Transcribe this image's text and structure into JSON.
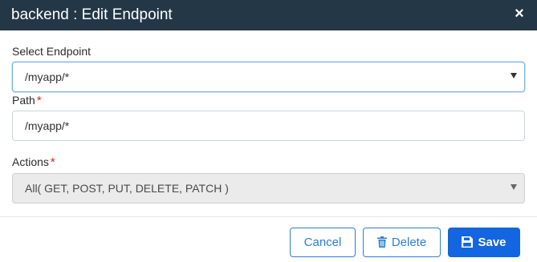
{
  "dialog": {
    "title": "backend : Edit Endpoint",
    "close_glyph": "×"
  },
  "form": {
    "select_endpoint": {
      "label": "Select Endpoint",
      "value": "/myapp/*"
    },
    "path": {
      "label": "Path",
      "required_mark": "*",
      "value": "/myapp/*"
    },
    "actions": {
      "label": "Actions",
      "required_mark": "*",
      "value": "All( GET, POST, PUT, DELETE, PATCH )"
    }
  },
  "footer": {
    "cancel_label": "Cancel",
    "delete_label": "Delete",
    "save_label": "Save"
  },
  "colors": {
    "header_bg": "#233746",
    "required": "#e0201a",
    "primary": "#1366e0",
    "outline": "#2c7fd0"
  },
  "icons": {
    "close": "close-icon",
    "caret": "caret-down-icon",
    "delete": "trash-icon",
    "save": "floppy-disk-icon"
  }
}
